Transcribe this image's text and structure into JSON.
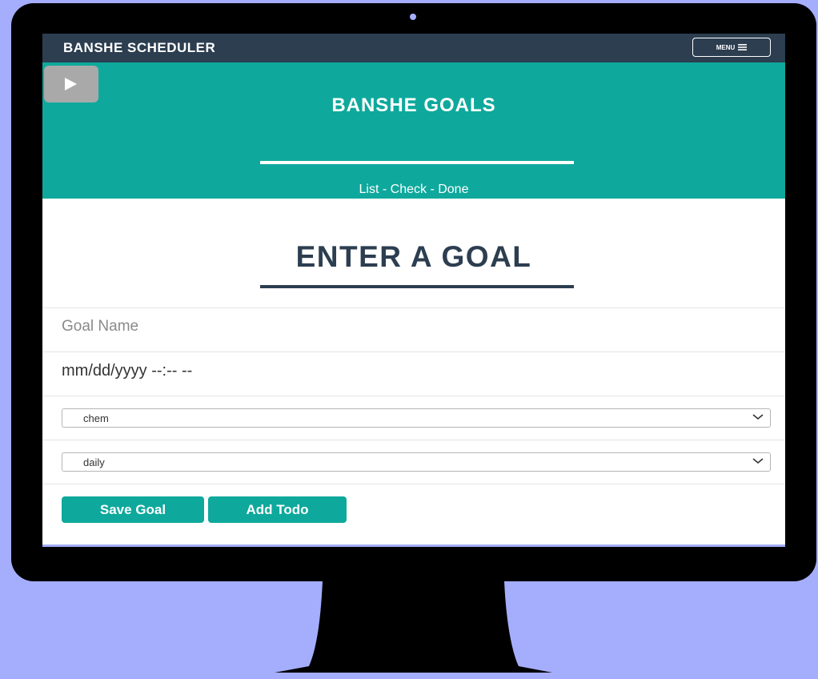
{
  "navbar": {
    "brand": "BANSHE SCHEDULER",
    "menu_label": "MENU",
    "menu_icon": "hamburger-icon"
  },
  "hero": {
    "play_icon": "play-icon",
    "title": "BANSHE GOALS",
    "subtitle": "List - Check - Done"
  },
  "form": {
    "title": "ENTER A GOAL",
    "goal_name_placeholder": "Goal Name",
    "goal_name_value": "",
    "date_placeholder": "mm/dd/yyyy --:-- --",
    "category_select": {
      "value": "chem"
    },
    "frequency_select": {
      "value": "daily"
    },
    "save_label": "Save Goal",
    "add_todo_label": "Add Todo"
  },
  "colors": {
    "background": "#a5aefc",
    "navbar": "#2c3e50",
    "accent": "#0ea99c",
    "heading": "#2c3e50"
  }
}
